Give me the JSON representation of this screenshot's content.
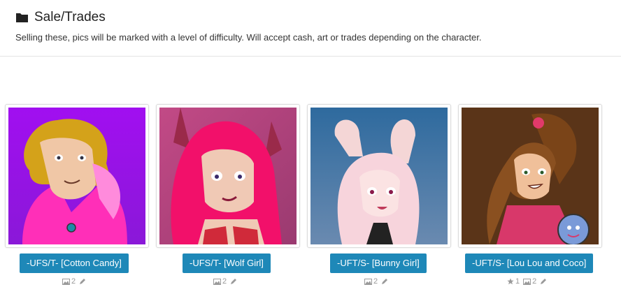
{
  "header": {
    "title": "Sale/Trades",
    "title_icon": "folder-icon",
    "description": "Selling these, pics will be marked with a level of difficulty. Will accept cash, art or trades depending on the character."
  },
  "items": [
    {
      "label": "-UFS/T- [Cotton Candy]",
      "images": "2",
      "background": "#a21ee0",
      "stats_icons": [
        "image-icon",
        "pencil-icon"
      ]
    },
    {
      "label": "-UFS/T- [Wolf Girl]",
      "images": "2",
      "background": "#b0447a",
      "stats_icons": [
        "image-icon",
        "pencil-icon"
      ]
    },
    {
      "label": "-UFT/S- [Bunny Girl]",
      "images": "2",
      "background": "#4a78a8",
      "stats_icons": [
        "image-icon",
        "pencil-icon"
      ]
    },
    {
      "label": "-UFT/S- [Lou Lou and Coco]",
      "favorites": "1",
      "images": "2",
      "background": "#5a3418",
      "stats_icons": [
        "star-icon",
        "image-icon",
        "pencil-icon"
      ]
    }
  ],
  "colors": {
    "button": "#1e88b8",
    "stats_text": "#9a9a9a"
  }
}
